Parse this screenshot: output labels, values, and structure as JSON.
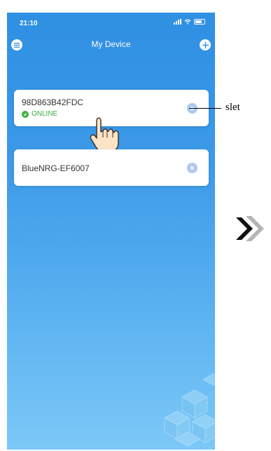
{
  "status_bar": {
    "time": "21:10"
  },
  "nav": {
    "title": "My Device"
  },
  "devices": [
    {
      "name": "98D863B42FDC",
      "status": "ONLINE"
    },
    {
      "name": "BlueNRG-EF6007"
    }
  ],
  "annotation": {
    "label": "slet"
  },
  "colors": {
    "primary_blue": "#2f8fe2",
    "online_green": "#3cae3f",
    "remove_button": "#a9c9f0",
    "arrow_dark": "#111111",
    "arrow_light": "#b5b5b5"
  },
  "icons": [
    "menu-icon",
    "plus-icon",
    "check-icon",
    "close-icon",
    "hand-pointer-icon",
    "double-chevron-right-icon"
  ]
}
